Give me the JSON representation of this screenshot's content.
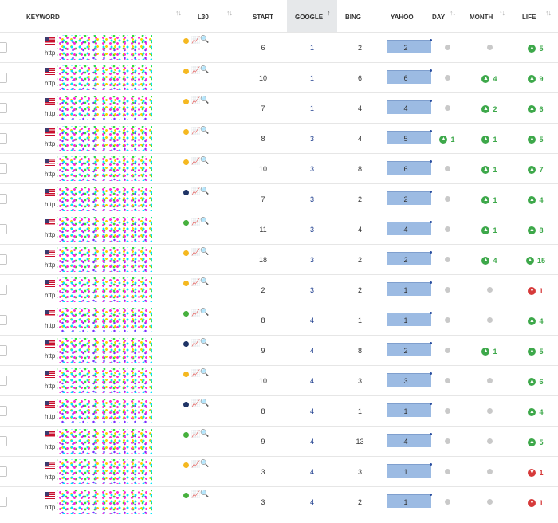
{
  "header": {
    "keyword": "KEYWORD",
    "l30": "L30",
    "start": "START",
    "google": "GOOGLE",
    "bing": "BING",
    "yahoo": "YAHOO",
    "day": "DAY",
    "month": "MONTH",
    "life": "LIFE",
    "sort_glyph": "↑↓",
    "google_sort_glyph": "↑"
  },
  "url_prefix": "http",
  "status_colors": {
    "yellow": "#f5b820",
    "navy": "#1f3466",
    "green": "#46b03d"
  },
  "rows": [
    {
      "status": "yellow",
      "start": "6",
      "google": "1",
      "bing": "2",
      "yahoo": "2",
      "day": null,
      "month": null,
      "life": {
        "dir": "up",
        "val": "5"
      }
    },
    {
      "status": "yellow",
      "start": "10",
      "google": "1",
      "bing": "6",
      "yahoo": "6",
      "day": null,
      "month": {
        "dir": "up",
        "val": "4"
      },
      "life": {
        "dir": "up",
        "val": "9"
      }
    },
    {
      "status": "yellow",
      "start": "7",
      "google": "1",
      "bing": "4",
      "yahoo": "4",
      "day": null,
      "month": {
        "dir": "up",
        "val": "2"
      },
      "life": {
        "dir": "up",
        "val": "6"
      }
    },
    {
      "status": "yellow",
      "start": "8",
      "google": "3",
      "bing": "4",
      "yahoo": "5",
      "day": {
        "dir": "up",
        "val": "1"
      },
      "month": {
        "dir": "up",
        "val": "1"
      },
      "life": {
        "dir": "up",
        "val": "5"
      }
    },
    {
      "status": "yellow",
      "start": "10",
      "google": "3",
      "bing": "8",
      "yahoo": "6",
      "day": null,
      "month": {
        "dir": "up",
        "val": "1"
      },
      "life": {
        "dir": "up",
        "val": "7"
      }
    },
    {
      "status": "navy",
      "start": "7",
      "google": "3",
      "bing": "2",
      "yahoo": "2",
      "day": null,
      "month": {
        "dir": "up",
        "val": "1"
      },
      "life": {
        "dir": "up",
        "val": "4"
      }
    },
    {
      "status": "green",
      "start": "11",
      "google": "3",
      "bing": "4",
      "yahoo": "4",
      "day": null,
      "month": {
        "dir": "up",
        "val": "1"
      },
      "life": {
        "dir": "up",
        "val": "8"
      }
    },
    {
      "status": "yellow",
      "start": "18",
      "google": "3",
      "bing": "2",
      "yahoo": "2",
      "day": null,
      "month": {
        "dir": "up",
        "val": "4"
      },
      "life": {
        "dir": "up",
        "val": "15"
      }
    },
    {
      "status": "yellow",
      "start": "2",
      "google": "3",
      "bing": "2",
      "yahoo": "1",
      "day": null,
      "month": null,
      "life": {
        "dir": "down",
        "val": "1"
      }
    },
    {
      "status": "green",
      "start": "8",
      "google": "4",
      "bing": "1",
      "yahoo": "1",
      "day": null,
      "month": null,
      "life": {
        "dir": "up",
        "val": "4"
      }
    },
    {
      "status": "navy",
      "start": "9",
      "google": "4",
      "bing": "8",
      "yahoo": "2",
      "day": null,
      "month": {
        "dir": "up",
        "val": "1"
      },
      "life": {
        "dir": "up",
        "val": "5"
      }
    },
    {
      "status": "yellow",
      "start": "10",
      "google": "4",
      "bing": "3",
      "yahoo": "3",
      "day": null,
      "month": null,
      "life": {
        "dir": "up",
        "val": "6"
      }
    },
    {
      "status": "navy",
      "start": "8",
      "google": "4",
      "bing": "1",
      "yahoo": "1",
      "day": null,
      "month": null,
      "life": {
        "dir": "up",
        "val": "4"
      }
    },
    {
      "status": "green",
      "start": "9",
      "google": "4",
      "bing": "13",
      "yahoo": "4",
      "day": null,
      "month": null,
      "life": {
        "dir": "up",
        "val": "5"
      }
    },
    {
      "status": "yellow",
      "start": "3",
      "google": "4",
      "bing": "3",
      "yahoo": "1",
      "day": null,
      "month": null,
      "life": {
        "dir": "down",
        "val": "1"
      }
    },
    {
      "status": "green",
      "start": "3",
      "google": "4",
      "bing": "2",
      "yahoo": "1",
      "day": null,
      "month": null,
      "life": {
        "dir": "down",
        "val": "1"
      }
    }
  ]
}
